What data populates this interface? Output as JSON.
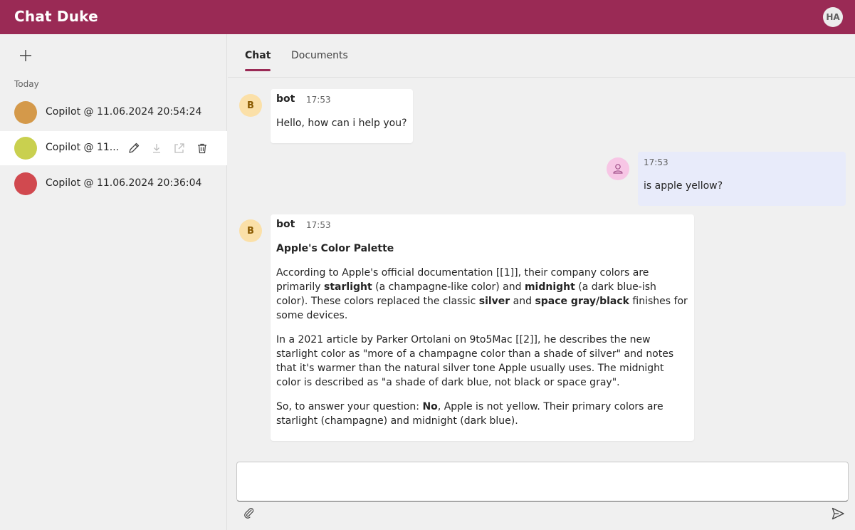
{
  "app": {
    "title": "Chat Duke",
    "user_initials": "HA",
    "accent_color": "#9a2a55"
  },
  "sidebar": {
    "new_chat_icon": "plus-icon",
    "section_label": "Today",
    "chats": [
      {
        "title": "Copilot @ 11.06.2024 20:54:24",
        "color": "#d4994a",
        "selected": false
      },
      {
        "title": "Copilot @ 11...",
        "color": "#c9d04f",
        "selected": true
      },
      {
        "title": "Copilot @ 11.06.2024 20:36:04",
        "color": "#d1494f",
        "selected": false
      }
    ],
    "row_actions": [
      "edit-icon",
      "download-icon",
      "share-icon",
      "delete-icon"
    ]
  },
  "tabs": [
    {
      "label": "Chat",
      "active": true
    },
    {
      "label": "Documents",
      "active": false
    }
  ],
  "messages": [
    {
      "role": "bot",
      "avatar": "B",
      "sender": "bot",
      "time": "17:53",
      "text": "Hello, how can i help you?"
    },
    {
      "role": "user",
      "time": "17:53",
      "text": "is apple yellow?"
    },
    {
      "role": "bot",
      "avatar": "B",
      "sender": "bot",
      "time": "17:53",
      "heading": "Apple's Color Palette",
      "p1": {
        "a": "According to Apple's official documentation [[1]], their company colors are primarily ",
        "b1": "starlight",
        "c": " (a champagne-like color) and ",
        "b2": "midnight",
        "d": " (a dark blue-ish color). These colors replaced the classic ",
        "b3": "silver",
        "e": " and ",
        "b4": "space gray/black",
        "f": " finishes for some devices."
      },
      "p2": "In a 2021 article by Parker Ortolani on 9to5Mac [[2]], he describes the new starlight color as \"more of a champagne color than a shade of silver\" and notes that it's warmer than the natural silver tone Apple usually uses. The midnight color is described as \"a shade of dark blue, not black or space gray\".",
      "p3": {
        "a": "So, to answer your question: ",
        "b": "No",
        "c": ", Apple is not yellow. Their primary colors are starlight (champagne) and midnight (dark blue)."
      }
    }
  ],
  "composer": {
    "placeholder": "",
    "value": "",
    "attach_icon": "paperclip-icon",
    "send_icon": "send-icon",
    "grammarly_icon": "grammarly-icon"
  }
}
